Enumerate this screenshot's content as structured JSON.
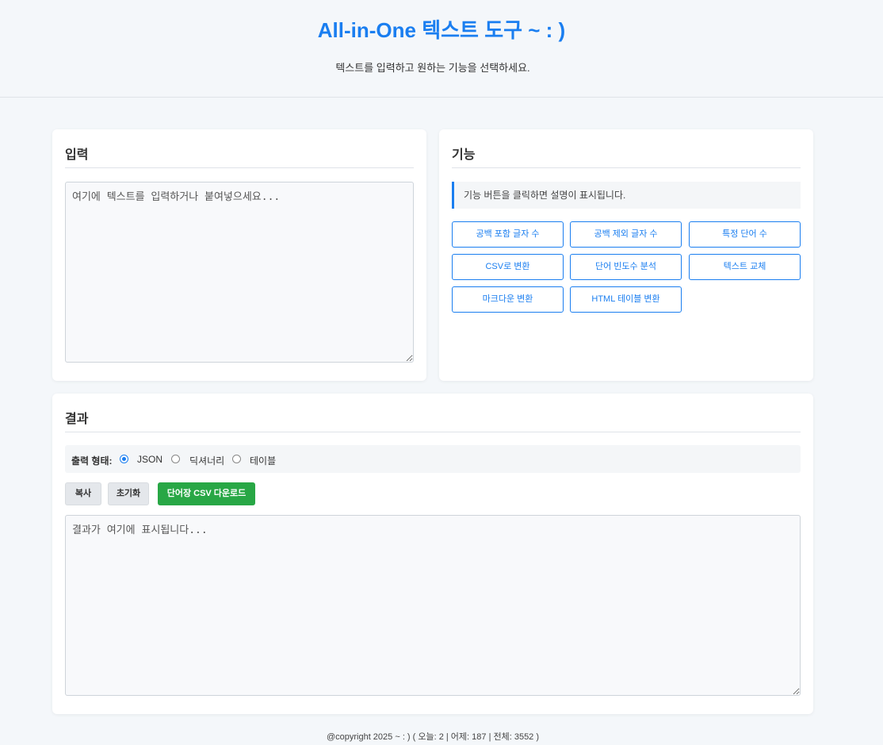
{
  "header": {
    "title": "All-in-One 텍스트 도구 ~ : )",
    "subtitle": "텍스트를 입력하고 원하는 기능을 선택하세요."
  },
  "input_card": {
    "title": "입력",
    "placeholder": "여기에 텍스트를 입력하거나 붙여넣으세요..."
  },
  "func_card": {
    "title": "기능",
    "description": "기능 버튼을 클릭하면 설명이 표시됩니다.",
    "buttons": [
      "공백 포함 글자 수",
      "공백 제외 글자 수",
      "특정 단어 수",
      "CSV로 변환",
      "단어 빈도수 분석",
      "텍스트 교체",
      "마크다운 변환",
      "HTML 테이블 변환"
    ]
  },
  "result_card": {
    "title": "결과",
    "format_label": "출력 형태:",
    "formats": [
      "JSON",
      "딕셔너리",
      "테이블"
    ],
    "selected_format": "JSON",
    "copy_label": "복사",
    "reset_label": "초기화",
    "download_label": "단어장 CSV 다운로드",
    "placeholder": "결과가 여기에 표시됩니다..."
  },
  "footer": {
    "text": "@copyright 2025 ~ : )  ( 오늘: 2 | 어제: 187 | 전체: 3552 )"
  },
  "colors": {
    "accent": "#1a7ef0",
    "download": "#28a745",
    "background": "#f4f7fa"
  }
}
